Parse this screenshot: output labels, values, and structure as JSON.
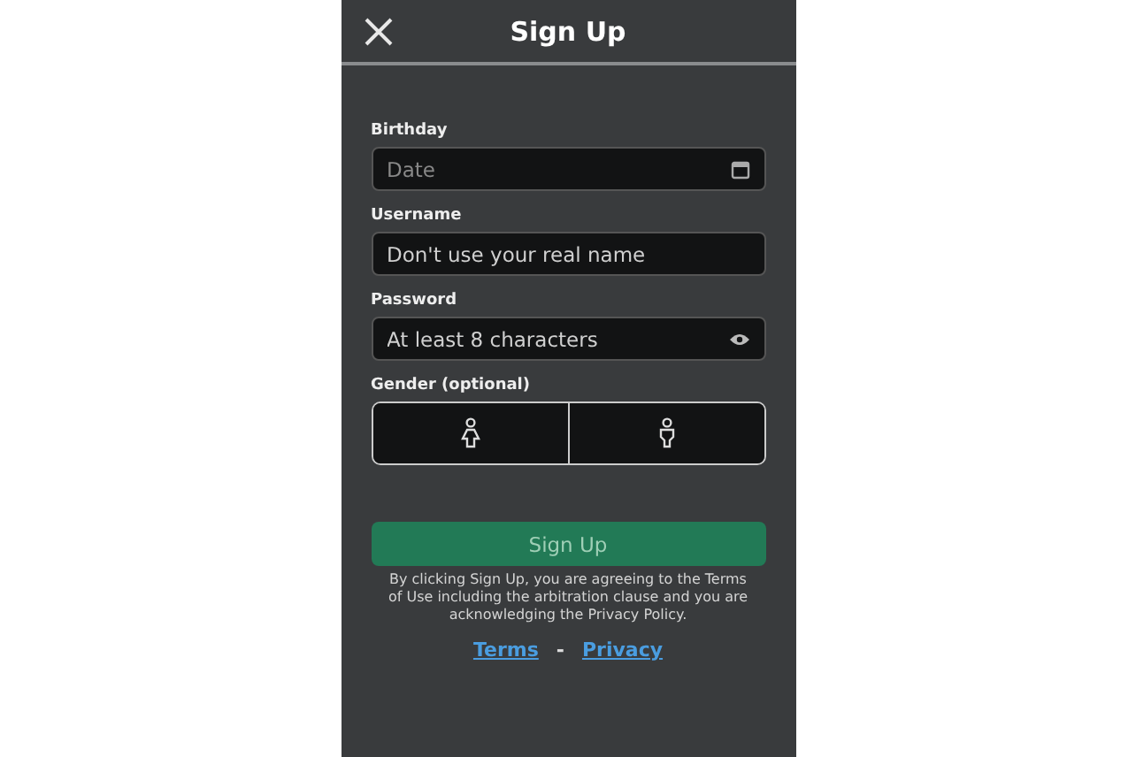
{
  "header": {
    "title": "Sign Up"
  },
  "fields": [
    {
      "label": "Birthday",
      "placeholder": "Date",
      "kind": "date"
    },
    {
      "label": "Username",
      "placeholder": "Don't use your real name",
      "kind": "text"
    },
    {
      "label": "Password",
      "placeholder": "At least 8 characters",
      "kind": "password"
    }
  ],
  "gender": {
    "label": "Gender (optional)",
    "options": [
      {
        "kind": "female",
        "selected": false
      },
      {
        "kind": "male",
        "selected": false
      }
    ]
  },
  "submit": {
    "label": "Sign Up",
    "disabled": true
  },
  "notice": "By clicking Sign Up, you are agreeing to the Terms of Use including the arbitration clause and you are acknowledging the Privacy Policy.",
  "links": [
    {
      "label": "Terms"
    },
    {
      "label": "Privacy"
    }
  ],
  "link_separator": "-"
}
